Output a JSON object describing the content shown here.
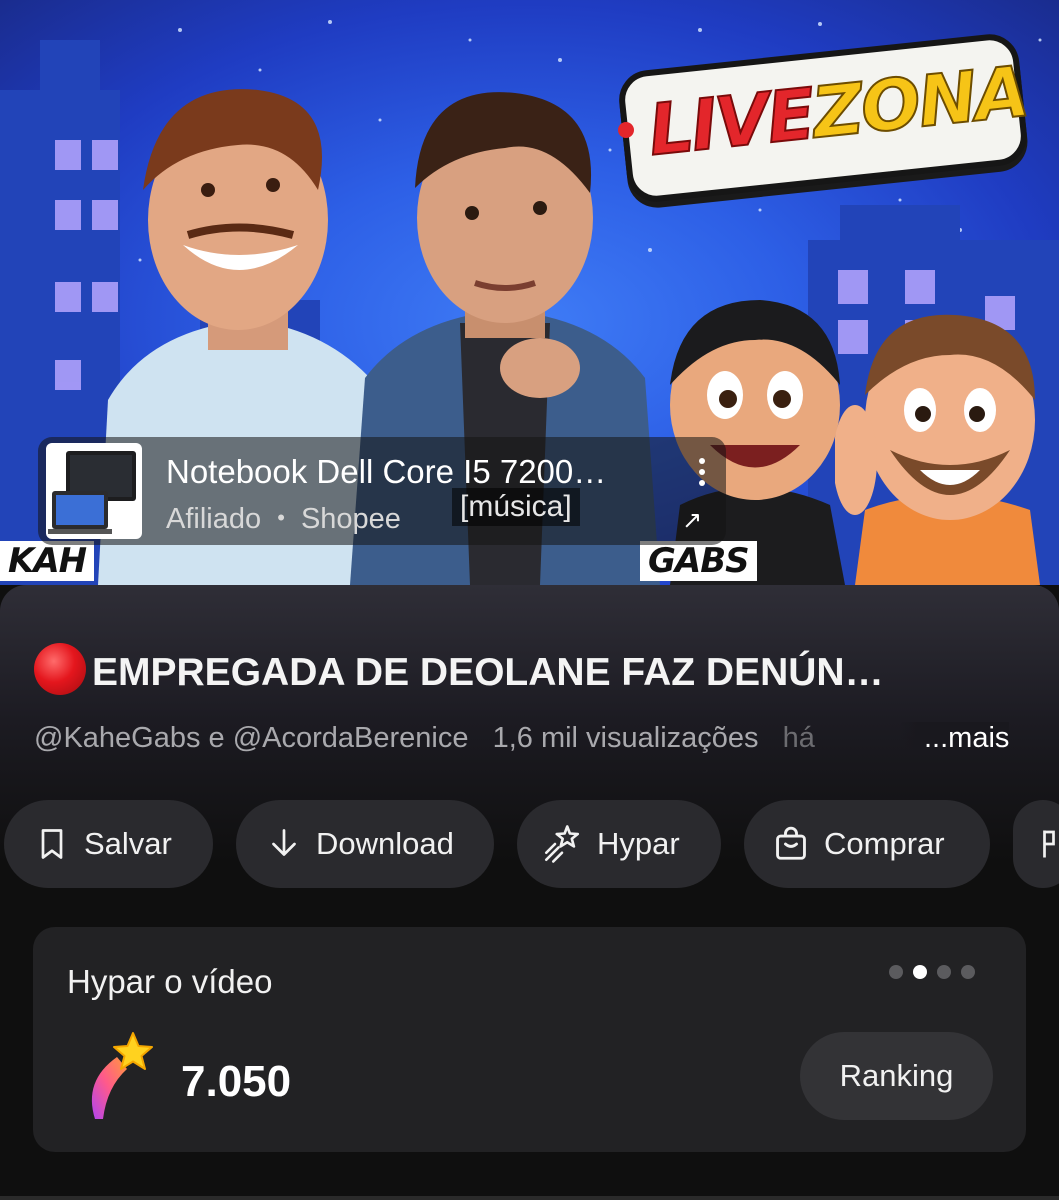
{
  "video": {
    "logo_live": "LIVE",
    "logo_zona": "ZONA",
    "tag_left": "KAH",
    "tag_right": "GABS",
    "caption": "[música]"
  },
  "product": {
    "title": "Notebook Dell Core I5 7200…",
    "meta_label": "Afiliado",
    "separator": "•",
    "store": "Shopee",
    "more_icon": "more-vert-icon",
    "open_icon": "open-external-icon"
  },
  "video_title": "EMPREGADA DE DEOLANE FAZ DENÚN…",
  "meta": {
    "channels": "@KaheGabs e @AcordaBerenice",
    "views": "1,6 mil visualizações",
    "time_fragment": "há",
    "more": "...mais"
  },
  "actions": [
    {
      "label": "Salvar",
      "icon": "bookmark-icon"
    },
    {
      "label": "Download",
      "icon": "download-icon"
    },
    {
      "label": "Hypar",
      "icon": "hype-icon"
    },
    {
      "label": "Comprar",
      "icon": "shopping-bag-icon"
    }
  ],
  "hype": {
    "title": "Hypar o vídeo",
    "count": "7.050",
    "ranking": "Ranking",
    "pager_total": 4,
    "pager_active": 2
  },
  "colors": {
    "background": "#0f0f0f",
    "chip": "#2a2a2e",
    "card": "#222224",
    "live_red": "#e4161d",
    "sky_blue": "#2d5fe6"
  }
}
